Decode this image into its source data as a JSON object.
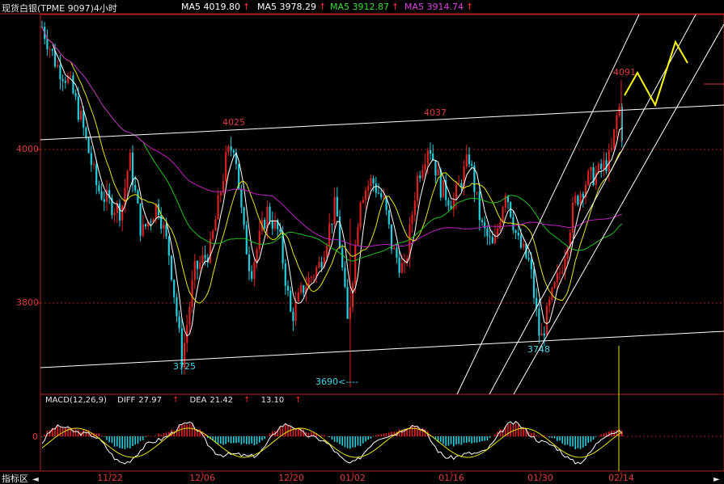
{
  "header": {
    "title": "现货白银(TPME 9097)4小时",
    "ma_items": [
      {
        "label": "MA5 4019.80",
        "color": "#ffffff"
      },
      {
        "label": "MA5 3978.29",
        "color": "#ffffff"
      },
      {
        "label": "MA5 3912.87",
        "color": "#33dd33"
      },
      {
        "label": "MA5 3914.74",
        "color": "#e040e0"
      }
    ],
    "arrow": "↑"
  },
  "chart_data": {
    "type": "candlestick",
    "y_ticks": [
      "4000",
      "3800"
    ],
    "y_tick_values": [
      4000,
      3800
    ],
    "ylim": [
      3630,
      4200
    ],
    "x_ticks": [
      "11/22",
      "12/06",
      "12/20",
      "01/02",
      "01/16",
      "01/30",
      "02/14"
    ],
    "annotations": {
      "p4091": "4091",
      "p4025": "4025",
      "p4037": "4037",
      "p3725": "3725",
      "p3748": "3748",
      "p3690": "3690<----"
    },
    "key_points": [
      {
        "label": "4091",
        "value": 4091
      },
      {
        "label": "4025",
        "value": 4025
      },
      {
        "label": "4037",
        "value": 4037
      },
      {
        "label": "3725",
        "value": 3725
      },
      {
        "label": "3748",
        "value": 3748
      },
      {
        "label": "3690",
        "value": 3690
      }
    ],
    "macd": {
      "title": "MACD(12,26,9)",
      "diff_label": "DIFF",
      "diff_value": "27.97",
      "dea_label": "DEA",
      "dea_value": "21.42",
      "hist_value": "13.10",
      "zero_label": "0"
    }
  },
  "footer": {
    "indicator_tab": "指标区",
    "arrow_left": "◄"
  },
  "colors": {
    "background": "#000000",
    "frame": "#b02020",
    "up": "#e02020",
    "down": "#20d0e0",
    "ma_fast": "#ffffff",
    "ma_mid": "#e6e600",
    "ma_green": "#20c020",
    "ma_purple": "#c020c0",
    "forecast": "#ffff00"
  }
}
